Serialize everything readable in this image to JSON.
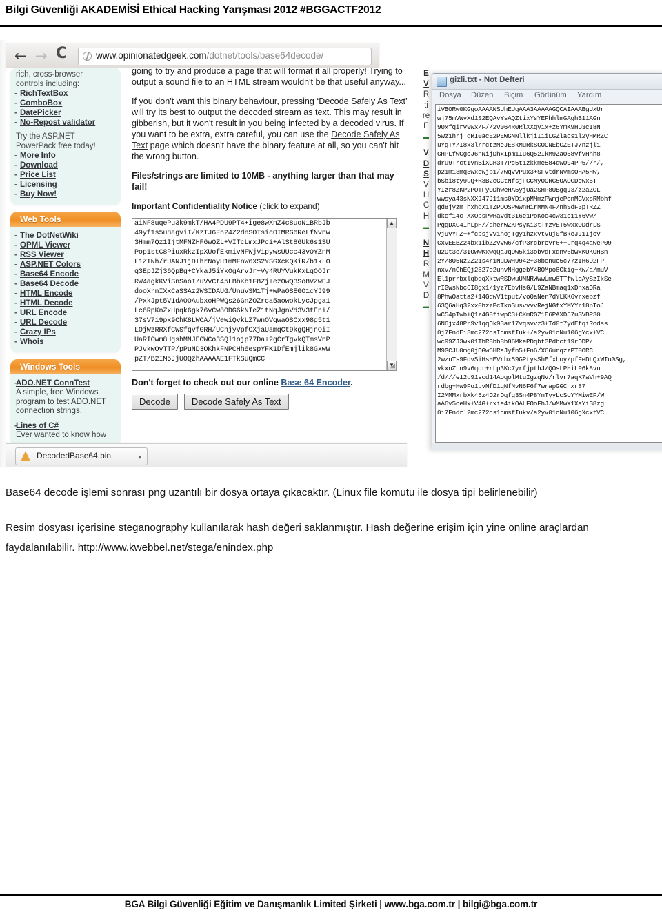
{
  "document": {
    "header_title": "Bilgi Güvenliği AKADEMİSİ Ethical Hacking Yarışması 2012 #BGGACTF2012",
    "footer_text": "BGA Bilgi Güvenliği Eğitim ve Danışmanlık Limited Şirketi | www.bga.com.tr | bilgi@bga.com.tr"
  },
  "screenshot": {
    "browser": {
      "back_icon": "←",
      "forward_icon": "→",
      "reload_icon": "C",
      "globe_icon": "globe-icon",
      "url_domain": "www.opinionatedgeek.com",
      "url_path": "/dotnet/tools/base64decode/"
    },
    "sidebar": {
      "intro_line1": "rich, cross-browser",
      "intro_line2": "controls including:",
      "controls": [
        "RichTextBox",
        "ComboBox",
        "DatePicker",
        "No-Repost validator"
      ],
      "promo_line1": "Try the ASP.NET",
      "promo_line2": "PowerPack free today!",
      "promo_links": [
        "More Info",
        "Download",
        "Price List",
        "Licensing",
        "Buy Now!"
      ],
      "web_tools_header": "Web Tools",
      "web_tools": [
        "The DotNetWiki",
        "OPML Viewer",
        "RSS Viewer",
        "ASP.NET Colors",
        "Base64 Encode",
        "Base64 Decode",
        "HTML Encode",
        "HTML Decode",
        "URL Encode",
        "URL Decode",
        "Crazy IPs",
        "Whois"
      ],
      "windows_tools_header": "Windows Tools",
      "windows_tools": [
        {
          "title": "ADO.NET ConnTest",
          "desc": "A simple, free Windows program to test ADO.NET connection strings."
        },
        {
          "title": "Lines of C#",
          "desc": "Ever wanted to know how"
        }
      ]
    },
    "main": {
      "para1": "going to try and produce a page that will format it all properly! Trying to output a sound file to an HTML stream wouldn't be that useful anyway...",
      "para2_a": "If you don't want this binary behaviour, pressing ‘Decode Safely As Text’ will try its best to output the decoded stream as text. This may result in gibberish, but it won't result in you being infected by a decoded virus. If you want to be extra, extra careful, you can use the ",
      "para2_link": "Decode Safely As Text",
      "para2_b": " page which doesn't have the binary feature at all, so you can't hit the wrong button.",
      "para3": "Files/strings are limited to 10MB - anything larger than that may fail!",
      "notice": "Important Confidentiality Notice",
      "notice_hint": " (click to expand)",
      "textarea_value": "aiNF8uqePu3k9mkT/HA4PDU9PT4+ige8wXnZ4c8uoN1BRbJb\n49yf1s5u8agviT/KzTJ6Fh24Z2dnSOTsicOIMRG6ReLfNvnw\n3Hmm7Qz1IjtMFNZHF6wQZL+VITcLmxJPci+AlSt86Uk6s1SU\nPop1stC8PiuxRkzIpXUofEkmivNFWjVipywsUUcc43vOYZnM\nL1ZINh/rUANJ1jD+hrNoyH1mMFnW6XS2YSGXcKQKiR/b1kLO\nq3EpJZj36QpBg+CYkaJ5iYkOgArvJr+Vy4RUYVukKxLqOOJr\nRW4agkKViSnSaoI/uVvCt45LBbKb1F8Zj+ezOwQ3So8VZwEJ\ndooXrnIXxCaSSAz2WSIDAUG/UnuVSM1Tj+wPaOSEGO1cYJ99\n/PxkJpt5V1dAOOAubxoHPWQs26GnZOZrca5aowokLycJpga1\nLc6RpKnZxHpqk6gk76vCw8ODG6kNIeZ1tNqJgnVd3V3tEni/\n37sV7i9px9ChK8LWOA/jVewiQvkLZ7wnOVqwaOSCxx98g5t1\nLOjWzRRXfCWSfqvfGRH/UCnjyVpfCXjaUamqCt9kgQHjnOiI\nUaRIOwm8HgshMNJEOWCo3SQl1ojp77Da+2gCrTgvkQTmsVnP\nPJvkwOyTTP/pPuND3OKhkFNPCHh6espYFK1DfEmjlik8GxwW\npZT/B2IM5JjUOQzhAAAAAE1FTkSuQmCC",
      "dont_forget_text": "Don't forget to check out our online ",
      "dont_forget_link": "Base 64 Encoder",
      "dont_forget_end": ".",
      "decode_button": "Decode",
      "decode_safely_button": "Decode Safely As Text"
    },
    "right_strip": [
      "E",
      "V",
      "R",
      "ti",
      "re",
      "E",
      "",
      "V",
      "D",
      "S",
      "V",
      "H",
      "C",
      "H",
      "",
      "N",
      "H",
      "R",
      "M",
      "V",
      "D"
    ],
    "download_bar": {
      "file_name": "DecodedBase64.bin",
      "icon": "download-file-icon",
      "caret": "▾"
    },
    "notepad": {
      "title": "gizli.txt - Not Defteri",
      "icon": "notepad-icon",
      "menu": [
        "Dosya",
        "Düzen",
        "Biçim",
        "Görünüm",
        "Yardım"
      ],
      "content": "iVBORw0KGgoAAAANSUhEUgAAA3AAAAAGQCAIAAABgUxUr\nwj75mVWvXd1S2EQAvYsAQZtixYsYEFhhlmGAghB11AGn\n90xfqirv9wx/F//2v064R0RlXXqyix+z6YmK9HD3cI8N\n5wz1hrjTgRI0acE2PEWGNNllkjiIiiLGZlacs1l2yHMRZC\nuYgTY/I8x3lrrctzMeJE8kMuRkSCOGNEbGZETJ7nzjl1\nGHPLfwCgoJ6nNijDhxIpm1Iu6Q52IkM9ZaO58vfvHhh8\ndru9TrctIvnBiXGH3T7Pc5t1zkkme584dwO94PP5//r/,\np21m13mq3wxcwjp1/7wqvvPux3+SFvtdrNvmsOHA5Hw,\nbSbi8ty9uQ+R3B2cGGtNfsjFGCNyOORG5OAOGDewx5T\nYIzr8ZKP2POTFyODhweHA5yjUa2SHP8UBgqJ3/z2aZOL\nwwsya43sNXXJ47J11ms0YD1xpMMmzPWmjePonMGVxsRMbhf\ngd8jyzmThxhgX1TZPOOSPWwnHirMMN4F/nhSdF3pTRZZ\ndkcf14cTXXOpsPWHavdt3I6e1PoKoc4cw31e11Y6vw/\nPggDXG4IhLpH//qherWZKPsyKi3tTmzyET5wxxODdrLS\nvj9vYFZ++fcbsjvv1hojTgy1hzxvtvuj0fBkeJJ1Ijev\nCxvEEBZ24bx1ibZZvVw6/cfP3rcbrevr6++urq4q4aweP09\nu2Ot3e/3IOwwKxwqQaJqOw5ki3obvdFxdnv6bwxKUKOHBn\n2Y/805Nz2Z21s4r1NuDwH9942+38bcnue5c77zIH6D2FP\nnxv/nGhEQj2827c2unvNHggebY4BOMpo8Ckig+Kw/a/muV\nEl1prrbxlqbqqXktwRSDwuUNNRWwwUmw8TTfwloAySzIkSe\nrIGwsNbc6I8gx1/1yz7EbvHsG/L9ZaNBmaq1xDnxaDRa\n8PhwOatta2+14GdwV1tput/vo0aNer7dYLKK6vrxebzf\n63Q6aHq32xx0hzzPcTkoSusvvvvRejNGfxYMYYr18pToJ\nwC54pTwb+Q1z4G8fiwpC3+CKmRGZ1E6PAXD57uSVBP30\n6N6jx48Pr9v1qqDk93ar17vqsvvz3+Td0t7ydEfqiRodss\n0j7FndEi3mc272csIcmsfIuk+/a2yv01oNu106gYcx+VC\nwc99ZJ3wk01TbR8bb8b86MkePDqbt3Pdbct19rDDP/\nM9GCJU0mg0jDGw6HRaJyfn5+Fn6/X66urqzzPT0ORC\n2wzuTs9FdvSiHsHEVrbx59GPtysShEfxboy/pfFeDLQxWIu0Sg,\nvkxnZLn9v6qqr+rLp3Kc7yrfjpthJ/QOsLPHiL96k8vu\n/d///e12u91scd14AoqolMtuIgzqNv/rlvr7aqK7aVh+9AQ\nrdbg+Hw9Fo1pvNfD1qNfNvN6F6f7wrapGGChxr87\nI2MMMxrbXk45z4D2rDqfg3Sn4P8YnTyyLcSoYYMiwEF/W\naA6v5oeHx+V4G+rxie4ikOALFOoFhJ/wMMwX1XaYiB8zg\n0i7Fndrl2mc272cs1cmsfIukv/a2yv01oNu106gXcxtVC"
    }
  },
  "explanation": {
    "para1": "Base64 decode işlemi sonrası png uzantılı bir dosya ortaya çıkacaktır. (Linux file komutu ile dosya tipi belirlenebilir)",
    "para2": "Resim dosyası içerisine steganography kullanılarak hash değeri saklanmıştır. Hash değerine erişim için yine online araçlardan faydalanılabilir. http://www.kwebbel.net/stega/enindex.php"
  }
}
